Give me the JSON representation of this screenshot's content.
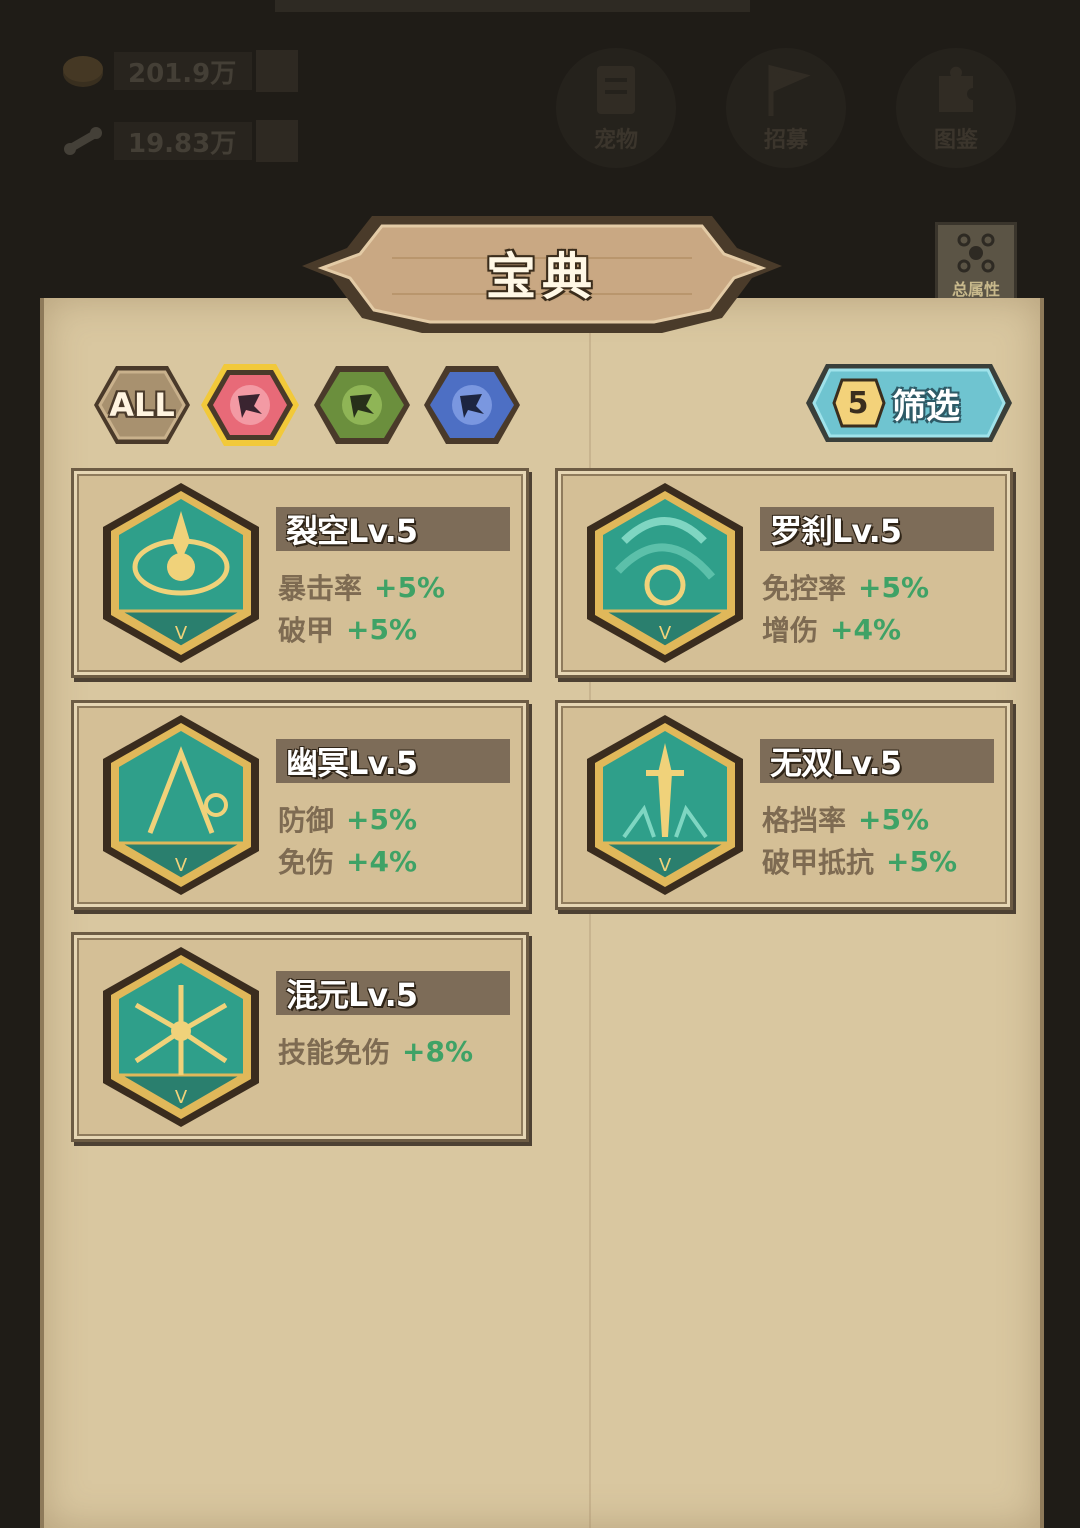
{
  "hud": {
    "resources": [
      {
        "icon": "coin-icon",
        "value": "201.9万"
      },
      {
        "icon": "bone-icon",
        "value": "19.83万"
      }
    ],
    "buttons": [
      {
        "icon": "book-icon",
        "label": "宠物"
      },
      {
        "icon": "flag-icon",
        "label": "招募"
      },
      {
        "icon": "puzzle-icon",
        "label": "图鉴"
      }
    ],
    "side_button": {
      "icon": "rune-grid-icon",
      "label": "总属性"
    }
  },
  "title": "宝典",
  "filters": [
    {
      "id": "all",
      "label": "ALL",
      "color": "#a8916f"
    },
    {
      "id": "red",
      "icon": "rune-red-icon",
      "color": "#e86a78",
      "selected": true
    },
    {
      "id": "green",
      "icon": "rune-green-icon",
      "color": "#6b8f3d"
    },
    {
      "id": "blue",
      "icon": "rune-blue-icon",
      "color": "#4d6fc4"
    }
  ],
  "screen_button": {
    "count": "5",
    "label": "筛选"
  },
  "cards": [
    {
      "name": "裂空Lv.5",
      "icon": "eye-rune-icon",
      "stats": [
        {
          "label": "暴击率",
          "value": "+5%"
        },
        {
          "label": "破甲",
          "value": "+5%"
        }
      ]
    },
    {
      "name": "罗刹Lv.5",
      "icon": "vortex-rune-icon",
      "stats": [
        {
          "label": "免控率",
          "value": "+5%"
        },
        {
          "label": "增伤",
          "value": "+4%"
        }
      ]
    },
    {
      "name": "幽冥Lv.5",
      "icon": "phantom-rune-icon",
      "stats": [
        {
          "label": "防御",
          "value": "+5%"
        },
        {
          "label": "免伤",
          "value": "+4%"
        }
      ]
    },
    {
      "name": "无双Lv.5",
      "icon": "sword-rune-icon",
      "stats": [
        {
          "label": "格挡率",
          "value": "+5%"
        },
        {
          "label": "破甲抵抗",
          "value": "+5%"
        }
      ]
    },
    {
      "name": "混元Lv.5",
      "icon": "cosmos-rune-icon",
      "stats": [
        {
          "label": "技能免伤",
          "value": "+8%"
        }
      ]
    }
  ],
  "emblem_tier": "V",
  "colors": {
    "parchment": "#d9c7a0",
    "card": "#d4bf96",
    "name_bar": "#7d6c58",
    "stat_label": "#7e6b52",
    "stat_value": "#3fa266",
    "emblem_teal": "#2f9f8a",
    "emblem_gold": "#e0b85a"
  }
}
